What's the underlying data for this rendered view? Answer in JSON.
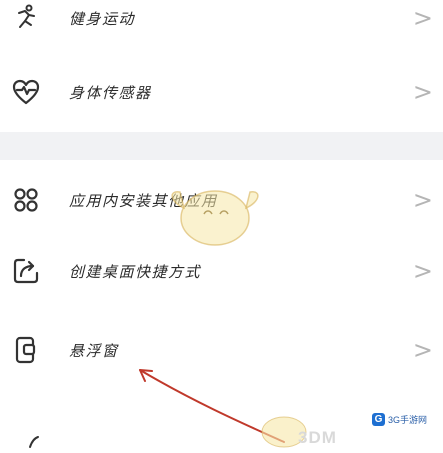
{
  "settings_list": {
    "items": [
      {
        "label": "健身运动",
        "icon": "fitness-icon"
      },
      {
        "label": "身体传感器",
        "icon": "heart-sensor-icon"
      },
      {
        "label": "应用内安装其他应用",
        "icon": "apps-grid-icon"
      },
      {
        "label": "创建桌面快捷方式",
        "icon": "shortcut-icon"
      },
      {
        "label": "悬浮窗",
        "icon": "floating-window-icon"
      }
    ],
    "chevron": ">"
  },
  "watermarks": {
    "logo_3dm": "3DM",
    "badge_letter": "G",
    "badge_text": "3G手游网"
  },
  "colors": {
    "background": "#ffffff",
    "separator_strip": "#f1f2f4",
    "text": "#2b2b2b",
    "chevron": "#b5b5b5",
    "annotation_arrow": "#c0392b"
  }
}
